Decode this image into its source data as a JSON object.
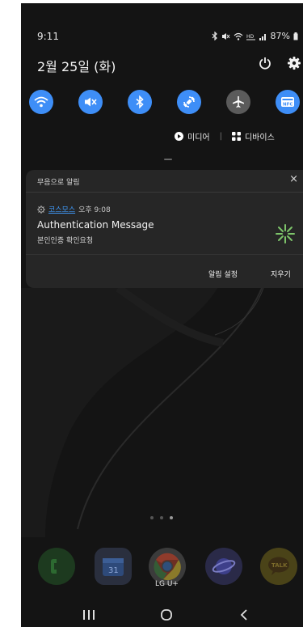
{
  "status_bar": {
    "time": "9:11",
    "battery": "87%"
  },
  "quick_panel": {
    "date": "2월 25일 (화)",
    "toggles": [
      {
        "id": "wifi",
        "state": "on"
      },
      {
        "id": "mute",
        "state": "on"
      },
      {
        "id": "bluetooth",
        "state": "on"
      },
      {
        "id": "auto-rotate",
        "state": "on"
      },
      {
        "id": "airplane",
        "state": "off"
      },
      {
        "id": "nfc",
        "state": "on",
        "label": "NFC"
      }
    ],
    "media_label": "미디어",
    "devices_label": "디바이스"
  },
  "notification": {
    "header": "무음으로 알림",
    "close": "×",
    "app_name": "코스모스",
    "time": "오후 9:08",
    "title": "Authentication Message",
    "body": "본인인증 확인요청",
    "actions": {
      "settings": "알림 설정",
      "clear": "지우기"
    }
  },
  "home": {
    "dock": [
      {
        "name": "phone",
        "label": ""
      },
      {
        "name": "calendar",
        "label": "31"
      },
      {
        "name": "chrome",
        "label": ""
      },
      {
        "name": "samsung-internet",
        "label": ""
      },
      {
        "name": "kakaotalk",
        "label": "TALK"
      }
    ],
    "carrier_label": "LG U+"
  },
  "colors": {
    "accent": "#3e8ef7",
    "link": "#3f97f4",
    "card": "#262626",
    "background": "#141414"
  }
}
